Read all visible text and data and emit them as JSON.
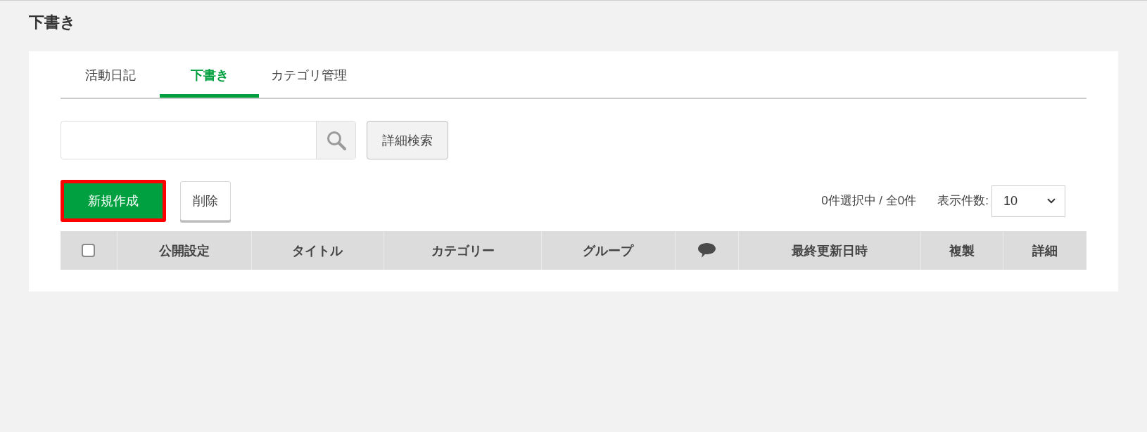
{
  "page": {
    "title": "下書き"
  },
  "tabs": [
    {
      "label": "活動日記",
      "selected": false
    },
    {
      "label": "下書き",
      "selected": true
    },
    {
      "label": "カテゴリ管理",
      "selected": false
    }
  ],
  "search": {
    "detail_button": "詳細検索"
  },
  "actions": [
    {
      "label": "新規作成",
      "kind": "primary",
      "highlighted": true
    },
    {
      "label": "削除",
      "kind": "secondary",
      "highlighted": false
    }
  ],
  "selection_summary": "0件選択中 / 全0件",
  "page_size": {
    "label": "表示件数:",
    "value": "10"
  },
  "table": {
    "columns": [
      {
        "kind": "checkbox",
        "checked": false
      },
      {
        "kind": "text",
        "label": "公開設定"
      },
      {
        "kind": "text",
        "label": "タイトル"
      },
      {
        "kind": "text",
        "label": "カテゴリー"
      },
      {
        "kind": "text",
        "label": "グループ"
      },
      {
        "kind": "icon"
      },
      {
        "kind": "text",
        "label": "最終更新日時"
      },
      {
        "kind": "text",
        "label": "複製"
      },
      {
        "kind": "text",
        "label": "詳細"
      }
    ]
  }
}
